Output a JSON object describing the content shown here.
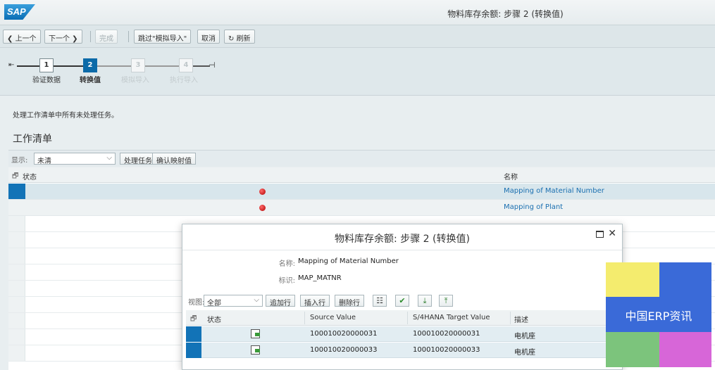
{
  "header": {
    "logo_text": "SAP",
    "title": "物料库存余额: 步骤 2 (转换值)"
  },
  "toolbar": {
    "prev": "上一个",
    "next": "下一个",
    "finish": "完成",
    "skip_sim": "跳过\"模拟导入\"",
    "cancel": "取消",
    "refresh": "刷新"
  },
  "roadmap": {
    "steps": [
      {
        "num": "1",
        "label": "验证数据",
        "state": "done"
      },
      {
        "num": "2",
        "label": "转换值",
        "state": "active"
      },
      {
        "num": "3",
        "label": "模拟导入",
        "state": "inactive"
      },
      {
        "num": "4",
        "label": "执行导入",
        "state": "inactive"
      }
    ]
  },
  "message": "处理工作清单中所有未处理任务。",
  "worklist": {
    "title": "工作清单",
    "show_label": "显示:",
    "show_value": "未清",
    "process_task": "处理任务",
    "confirm_mapping": "确认映射值",
    "columns": {
      "status": "状态",
      "name": "名称"
    },
    "rows": [
      {
        "status": "error",
        "name": "Mapping of Material Number"
      },
      {
        "status": "error",
        "name": "Mapping of Plant"
      }
    ]
  },
  "dialog": {
    "title": "物料库存余额: 步骤 2 (转换值)",
    "name_label": "名称:",
    "name_value": "Mapping of Material Number",
    "id_label": "标识:",
    "id_value": "MAP_MATNR",
    "view_label": "视图:",
    "view_value": "全部",
    "append_row": "追加行",
    "insert_row": "插入行",
    "delete_row": "删除行",
    "columns": {
      "status": "状态",
      "source": "Source Value",
      "target": "S/4HANA Target Value",
      "desc": "描述"
    },
    "rows": [
      {
        "source": "100010020000031",
        "target": "100010020000031",
        "desc": "电机座"
      },
      {
        "source": "100010020000033",
        "target": "100010020000033",
        "desc": "电机座"
      }
    ]
  },
  "watermark": {
    "text": "中国ERP资讯",
    "colors": {
      "yellow": "#f4ec6e",
      "blue": "#3a6ad8",
      "green": "#7cc47c",
      "magenta": "#d766d8"
    }
  }
}
